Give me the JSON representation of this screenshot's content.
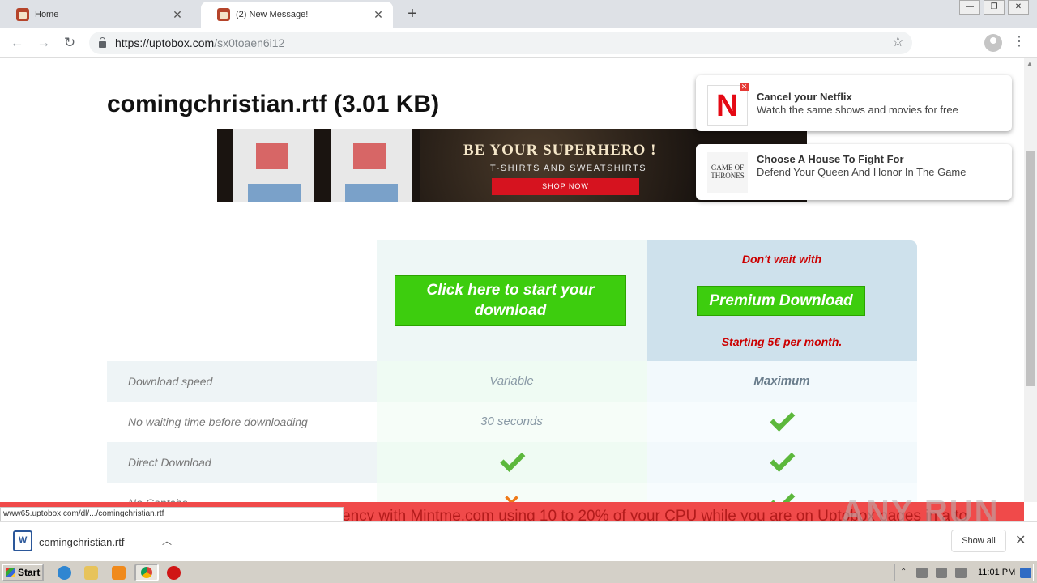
{
  "browser": {
    "tabs": [
      {
        "title": "Home",
        "active": false
      },
      {
        "title": "(2) New Message!",
        "active": true
      }
    ],
    "url_host": "https://uptobox.com",
    "url_path": "/sx0toaen6i12",
    "newtab_icon": "plus-icon"
  },
  "page": {
    "file_title": "comingchristian.rtf (3.01 KB)",
    "banner": {
      "headline": "BE YOUR SUPERHERO !",
      "sub": "T-SHIRTS AND SWEATSHIRTS",
      "shop": "SHOP NOW"
    },
    "free": {
      "button": "Click here to start your download"
    },
    "premium": {
      "dont_wait": "Don't wait with",
      "button": "Premium Download",
      "starting": "Starting 5€ per month."
    },
    "rows": [
      {
        "label": "Download speed",
        "free": "Variable",
        "premium": "Maximum"
      },
      {
        "label": "No waiting time before downloading",
        "free": "30 seconds",
        "premium": "check"
      },
      {
        "label": "Direct Download",
        "free": "check",
        "premium": "check"
      },
      {
        "label": "No Captcha",
        "free": "cross",
        "premium": "check"
      }
    ],
    "notifications": [
      {
        "title": "Cancel your Netflix",
        "body": "Watch the same shows and movies for free",
        "logo": "N"
      },
      {
        "title": "Choose A House To Fight For",
        "body": "Defend Your Queen And Honor In The Game",
        "logo": "GAME OF THRONES"
      }
    ],
    "ticker": "ency with Mintme.com using 10 to 20% of your CPU while you are on Uptobox pages in a to",
    "status_url": "www65.uptobox.com/dl/.../comingchristian.rtf",
    "watermark": "ANY RUN"
  },
  "downloads": {
    "file": "comingchristian.rtf",
    "show_all": "Show all"
  },
  "taskbar": {
    "start": "Start",
    "clock": "11:01 PM"
  },
  "colors": {
    "green_button": "#3dcd0e",
    "premium_red": "#cc0000",
    "ticker_bg": "#f04a4a"
  }
}
